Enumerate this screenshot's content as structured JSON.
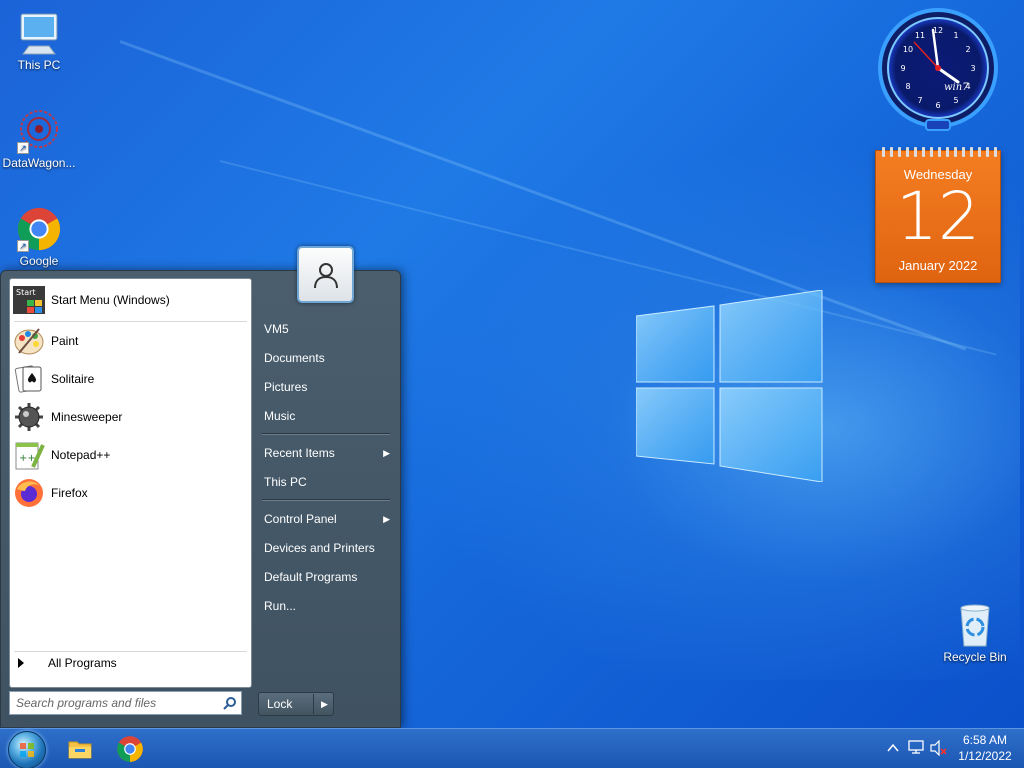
{
  "desktop": {
    "icons": [
      {
        "label": "This PC",
        "icon": "monitor-icon"
      },
      {
        "label": "DataWagon...",
        "icon": "datawagon-icon"
      },
      {
        "label": "Google",
        "icon": "chrome-icon"
      },
      {
        "label": "Recycle Bin",
        "icon": "recycle-bin-icon"
      }
    ],
    "wallpaper": "windows-10-hero"
  },
  "clock_gadget": {
    "brand": "win7",
    "numerals": [
      "12",
      "1",
      "2",
      "3",
      "4",
      "5",
      "6",
      "7",
      "8",
      "9",
      "10",
      "11"
    ]
  },
  "calendar_gadget": {
    "weekday": "Wednesday",
    "day": "12",
    "month_year": "January 2022",
    "color": "#e86a15"
  },
  "start_menu": {
    "programs": [
      {
        "label": "Start Menu (Windows)",
        "icon": "start-menu-app-icon"
      },
      {
        "label": "Paint",
        "icon": "paint-palette-icon"
      },
      {
        "label": "Solitaire",
        "icon": "solitaire-cards-icon"
      },
      {
        "label": "Minesweeper",
        "icon": "mine-icon"
      },
      {
        "label": "Notepad++",
        "icon": "notepad-plus-icon"
      },
      {
        "label": "Firefox",
        "icon": "firefox-icon"
      }
    ],
    "start_icon_text": "Start",
    "all_programs": "All Programs",
    "search_placeholder": "Search programs and files",
    "right": {
      "user": "VM5",
      "documents": "Documents",
      "pictures": "Pictures",
      "music": "Music",
      "recent_items": "Recent Items",
      "this_pc": "This PC",
      "control_panel": "Control Panel",
      "devices_printers": "Devices and Printers",
      "default_programs": "Default Programs",
      "run": "Run..."
    },
    "lock": "Lock"
  },
  "taskbar": {
    "pinned": [
      "file-explorer-icon",
      "chrome-icon"
    ],
    "tray": [
      "chevron-up-icon",
      "network-icon",
      "volume-muted-icon"
    ],
    "time": "6:58 AM",
    "date": "1/12/2022"
  }
}
